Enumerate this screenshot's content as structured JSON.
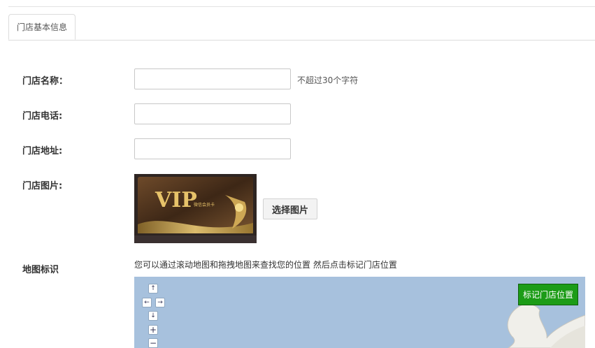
{
  "tabs": [
    {
      "label": "门店基本信息"
    }
  ],
  "form": {
    "name_label": "门店名称：",
    "name_value": "",
    "name_hint": "不超过30个字符",
    "phone_label": "门店电话:",
    "phone_value": "",
    "address_label": "门店地址:",
    "address_value": "",
    "image_label": "门店图片:",
    "image_text": "VIP",
    "image_subtext": "微信会员卡",
    "pick_image_label": "选择图片",
    "map_label": "地图标识",
    "map_hint": "您可以通过滚动地图和拖拽地图来查找您的位置 然后点击标记门店位置"
  },
  "map": {
    "mark_button_label": "标记门店位置",
    "nav": {
      "up": "↑",
      "left": "←",
      "right": "→",
      "down": "↓",
      "zoom_in": "+",
      "zoom_out": "−"
    },
    "colors": {
      "water": "#a7c1dd",
      "land": "#f0efea",
      "mark_button": "#1c9c17"
    }
  }
}
